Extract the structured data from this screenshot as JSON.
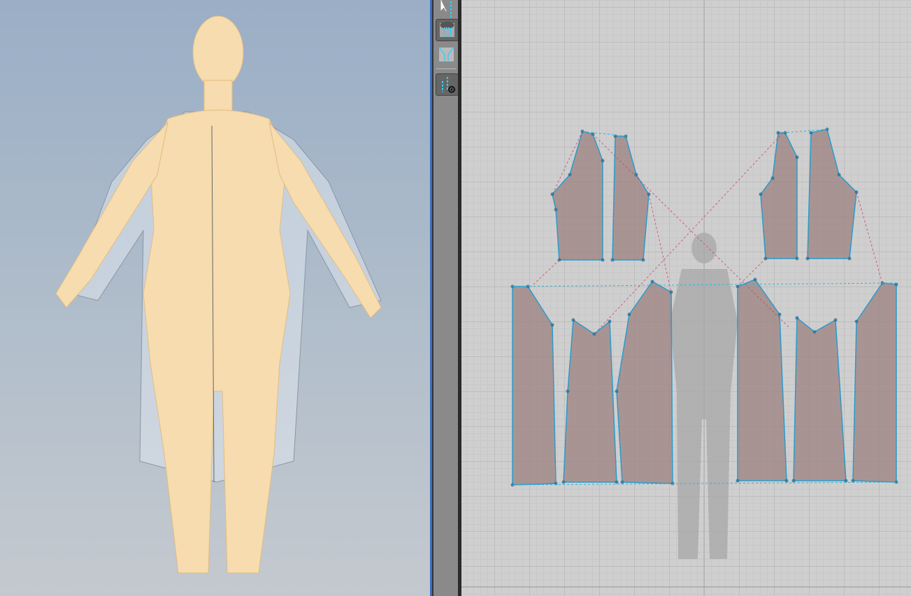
{
  "toolbar": {
    "tools": [
      {
        "icon": "select-move-point-icon"
      },
      {
        "icon": "fold-arrangement-icon"
      },
      {
        "icon": "unfold-arrangement-icon"
      },
      {
        "icon": "show-pins-points-icon"
      }
    ]
  },
  "colors": {
    "viewport_bg": "#9aaec6",
    "grid_bg": "#cfcfcf",
    "pattern_fill": "#9c8080",
    "outline": "#2b9bc9",
    "seam_red": "#c0304a",
    "accent": "#3a6fc0"
  }
}
